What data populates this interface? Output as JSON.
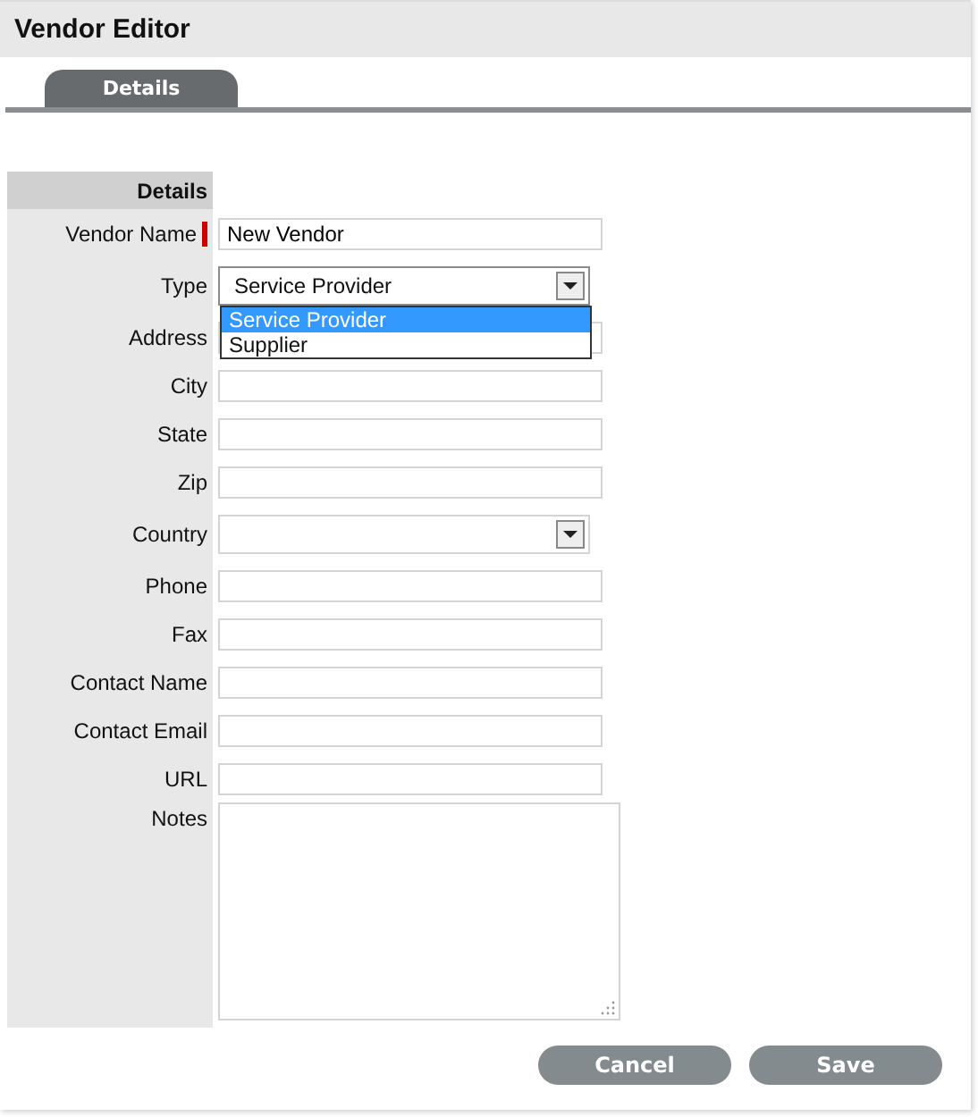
{
  "window": {
    "title": "Vendor Editor"
  },
  "tabs": [
    {
      "label": "Details",
      "selected": true
    }
  ],
  "section": {
    "title": "Details"
  },
  "fields": [
    {
      "kind": "text",
      "label": "Vendor Name",
      "value": "New Vendor",
      "required": true
    },
    {
      "kind": "select",
      "label": "Type",
      "value": "Service Provider",
      "required": false,
      "expanded": true,
      "options": [
        {
          "label": "Service Provider",
          "selected": true
        },
        {
          "label": "Supplier",
          "selected": false
        }
      ]
    },
    {
      "kind": "text",
      "label": "Address",
      "required": false
    },
    {
      "kind": "text",
      "label": "City",
      "required": false
    },
    {
      "kind": "text",
      "label": "State",
      "required": false
    },
    {
      "kind": "text",
      "label": "Zip",
      "required": false
    },
    {
      "kind": "select",
      "label": "Country",
      "required": false,
      "expanded": false
    },
    {
      "kind": "text",
      "label": "Phone",
      "required": false
    },
    {
      "kind": "text",
      "label": "Fax",
      "required": false
    },
    {
      "kind": "text",
      "label": "Contact Name",
      "required": false
    },
    {
      "kind": "text",
      "label": "Contact Email",
      "required": false
    },
    {
      "kind": "text",
      "label": "URL",
      "required": false
    },
    {
      "kind": "textarea",
      "label": "Notes",
      "required": false
    }
  ],
  "buttons": [
    {
      "label": "Cancel"
    },
    {
      "label": "Save"
    }
  ]
}
